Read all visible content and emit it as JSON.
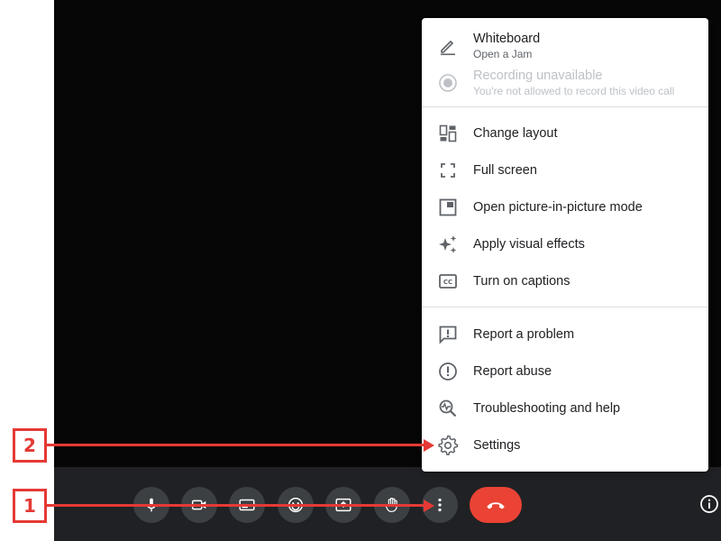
{
  "menu": {
    "items": [
      {
        "label": "Whiteboard",
        "sublabel": "Open a Jam",
        "icon": "pencil-icon"
      },
      {
        "label": "Recording unavailable",
        "sublabel": "You're not allowed to record this video call",
        "icon": "record-icon",
        "disabled": true
      },
      {
        "label": "Change layout",
        "icon": "layout-icon"
      },
      {
        "label": "Full screen",
        "icon": "fullscreen-icon"
      },
      {
        "label": "Open picture-in-picture mode",
        "icon": "picture-in-picture-icon"
      },
      {
        "label": "Apply visual effects",
        "icon": "sparkle-icon"
      },
      {
        "label": "Turn on captions",
        "icon": "captions-icon"
      },
      {
        "label": "Report a problem",
        "icon": "report-problem-icon"
      },
      {
        "label": "Report abuse",
        "icon": "report-abuse-icon"
      },
      {
        "label": "Troubleshooting and help",
        "icon": "troubleshoot-icon"
      },
      {
        "label": "Settings",
        "icon": "gear-icon"
      }
    ]
  },
  "toolbar": {
    "buttons": [
      "microphone-icon",
      "camera-icon",
      "captions-icon",
      "emoji-icon",
      "present-icon",
      "raise-hand-icon",
      "more-options-icon"
    ],
    "end_call_icon": "hang-up-icon",
    "info_icon": "info-icon"
  },
  "callouts": [
    {
      "number": "1",
      "target": "more-options-button"
    },
    {
      "number": "2",
      "target": "menu-item-settings"
    }
  ],
  "colors": {
    "accent_red": "#e53935",
    "end_call": "#ea4335",
    "toolbar_bg": "#202124",
    "video_bg": "#060606",
    "menu_text": "#202124",
    "menu_icon": "#5f6368"
  }
}
